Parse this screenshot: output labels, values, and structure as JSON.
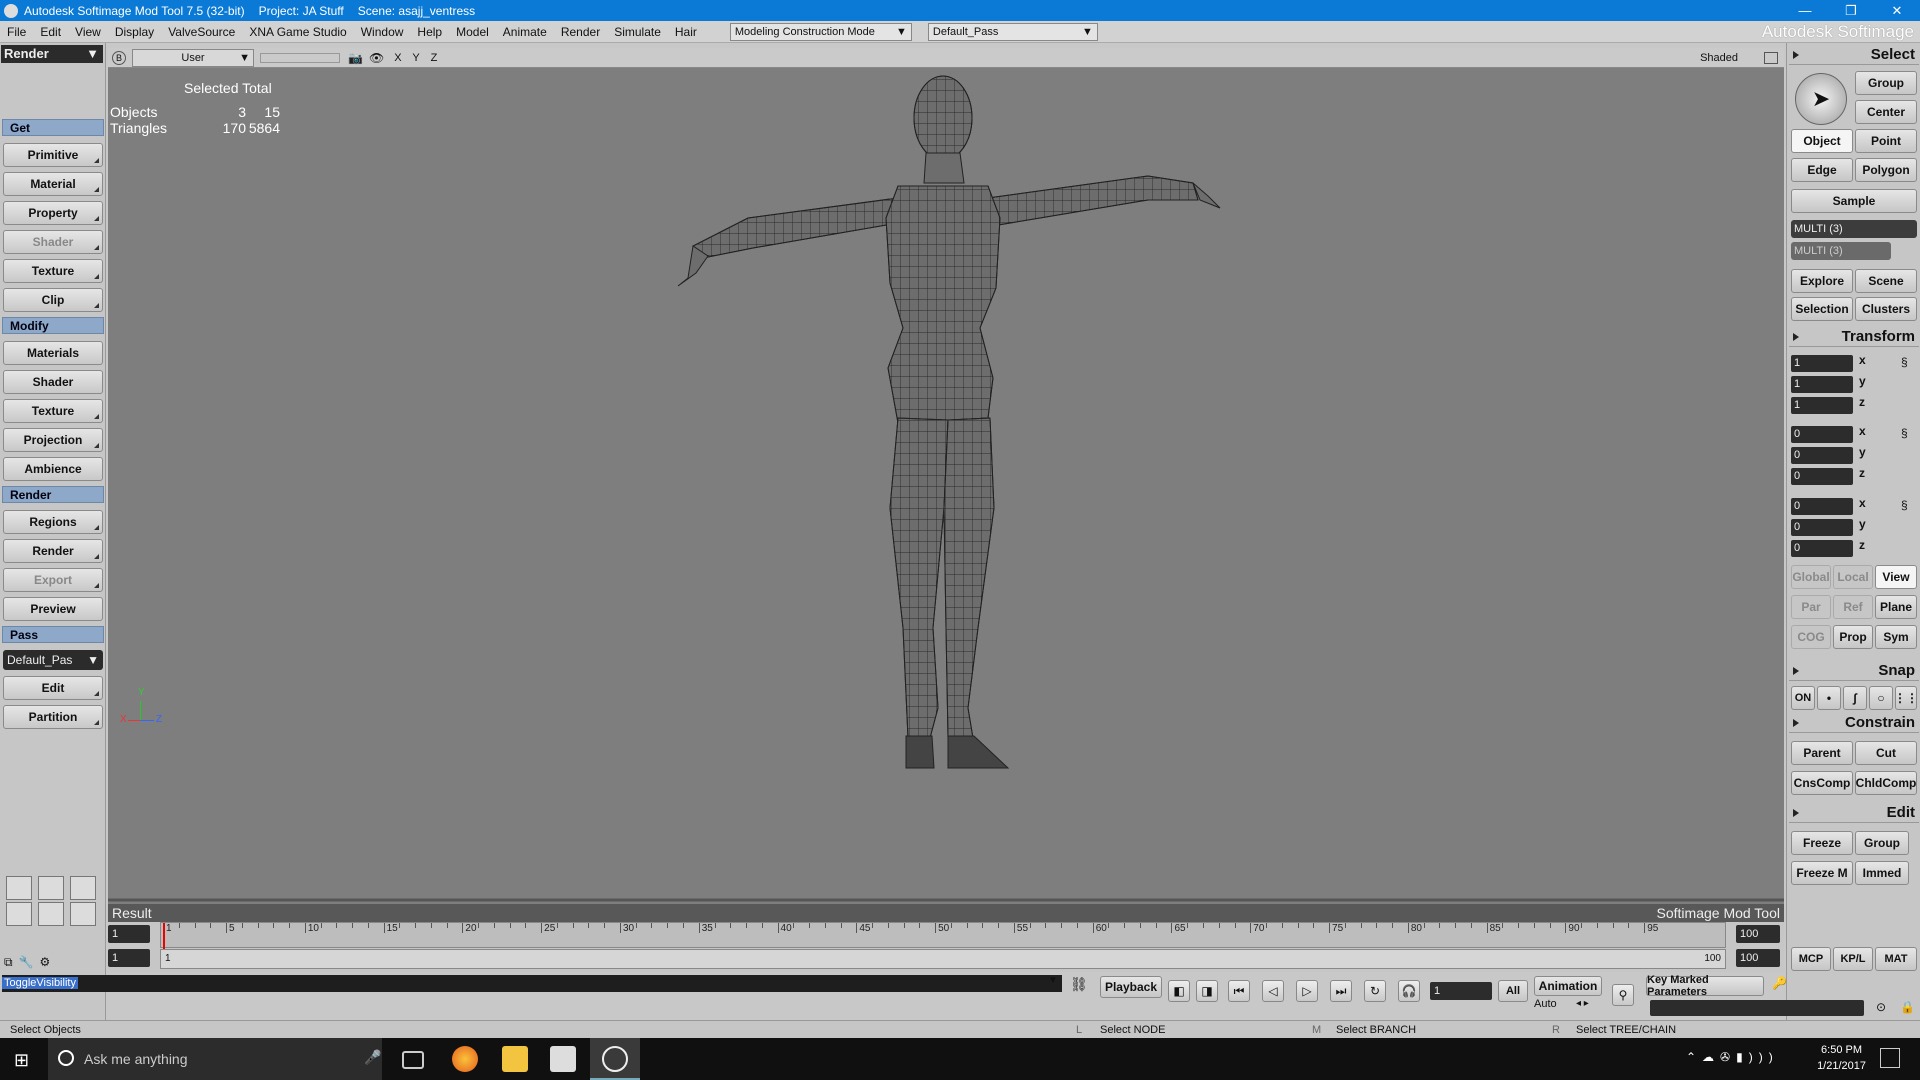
{
  "window": {
    "title": "Autodesk Softimage Mod Tool 7.5 (32-bit)",
    "project": "Project: JA Stuff",
    "scene": "Scene: asajj_ventress"
  },
  "menu": [
    "File",
    "Edit",
    "View",
    "Display",
    "ValveSource",
    "XNA Game Studio",
    "Window",
    "Help",
    "Model",
    "Animate",
    "Render",
    "Simulate",
    "Hair"
  ],
  "mode_combo": "Modeling Construction Mode",
  "pass_combo": "Default_Pass",
  "brand": "Autodesk Softimage",
  "left": {
    "dropdown": "Render",
    "get": {
      "header": "Get",
      "items": [
        "Primitive",
        "Material",
        "Property",
        "Shader",
        "Texture",
        "Clip"
      ]
    },
    "modify": {
      "header": "Modify",
      "items": [
        "Materials",
        "Shader",
        "Texture",
        "Projection",
        "Ambience"
      ]
    },
    "render": {
      "header": "Render",
      "items": [
        "Regions",
        "Render",
        "Export",
        "Preview"
      ]
    },
    "pass": {
      "header": "Pass",
      "combo": "Default_Pas",
      "items": [
        "Edit",
        "Partition"
      ]
    }
  },
  "viewport": {
    "camera": "User",
    "axes": "X Y Z",
    "shading": "Shaded",
    "stats": {
      "head": "Selected Total",
      "objects_label": "Objects",
      "objects_sel": "3",
      "objects_total": "15",
      "tri_label": "Triangles",
      "tri_sel": "170",
      "tri_total": "5864"
    },
    "result": "Result",
    "product": "Softimage Mod Tool",
    "axis_x": "X",
    "axis_y": "Y",
    "axis_z": "Z"
  },
  "right": {
    "select": "Select",
    "group": "Group",
    "center": "Center",
    "object": "Object",
    "point": "Point",
    "edge": "Edge",
    "polygon": "Polygon",
    "sample": "Sample",
    "multi1": "MULTI (3)",
    "multi2": "MULTI (3)",
    "explore": "Explore",
    "scene": "Scene",
    "selection": "Selection",
    "clusters": "Clusters",
    "transform": "Transform",
    "scale": [
      "1",
      "1",
      "1"
    ],
    "rot": [
      "0",
      "0",
      "0"
    ],
    "trans": [
      "0",
      "0",
      "0"
    ],
    "ax": "x",
    "ay": "y",
    "az": "z",
    "global": "Global",
    "local": "Local",
    "view": "View",
    "par": "Par",
    "ref": "Ref",
    "plane": "Plane",
    "cog": "COG",
    "prop": "Prop",
    "sym": "Sym",
    "snap": "Snap",
    "on": "ON",
    "constrain": "Constrain",
    "parent": "Parent",
    "cut": "Cut",
    "cnscomp": "CnsComp",
    "chldcomp": "ChldComp",
    "edit": "Edit",
    "freeze": "Freeze",
    "group2": "Group",
    "freezem": "Freeze M",
    "immed": "Immed",
    "mcp": "MCP",
    "kplp": "KP/L",
    "mat": "MAT"
  },
  "timeline": {
    "start": "1",
    "end": "100",
    "start2": "1",
    "cur": "1",
    "end2": "100",
    "end3": "100",
    "ticks": [
      "1",
      "5",
      "10",
      "15",
      "20",
      "25",
      "30",
      "35",
      "40",
      "45",
      "50",
      "55",
      "60",
      "65",
      "70",
      "75",
      "80",
      "85",
      "90",
      "95"
    ]
  },
  "command": "ToggleVisibility",
  "playback": "Playback",
  "frame": "1",
  "all": "All",
  "animation": "Animation",
  "auto": "Auto",
  "kmp": "Key Marked Parameters",
  "status": {
    "left": "Select Objects",
    "l": "L",
    "lnode": "Select NODE",
    "m": "M",
    "mbranch": "Select BRANCH",
    "r": "R",
    "rtree": "Select TREE/CHAIN"
  },
  "taskbar": {
    "search": "Ask me anything",
    "time": "6:50 PM",
    "date": "1/21/2017"
  }
}
